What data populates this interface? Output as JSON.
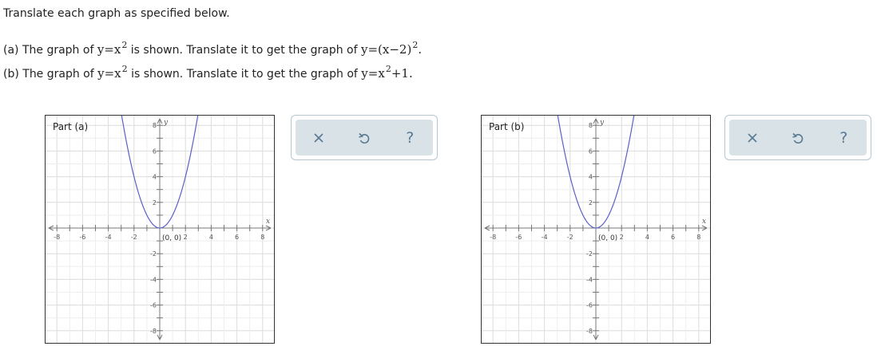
{
  "instructions": "Translate each graph as specified below.",
  "part_a": {
    "prefix": "(a) The graph of",
    "given_eq": "y=x",
    "given_exp": "2",
    "middle": "is shown. Translate it to get the graph of",
    "target_eq": "y=(x−2)",
    "target_exp": "2",
    "suffix": "."
  },
  "part_b": {
    "prefix": "(b) The graph of",
    "given_eq": "y=x",
    "given_exp": "2",
    "middle": "is shown. Translate it to get the graph of",
    "target_eq": "y=x",
    "target_exp": "2",
    "target_tail": "+1",
    "suffix": "."
  },
  "graphs": [
    {
      "label": "Part (a)",
      "vertex_label": "(0, 0)",
      "x_ticks": [
        "-8",
        "-6",
        "-4",
        "-2",
        "2",
        "4",
        "6",
        "8"
      ],
      "y_ticks": [
        "8",
        "6",
        "4",
        "2",
        "-2",
        "-4",
        "-6",
        "-8"
      ],
      "x_axis_label": "x",
      "y_axis_label": "y",
      "curve": {
        "equation": "y=x^2",
        "color": "#5b5fc7",
        "vertex": [
          0,
          0
        ]
      }
    },
    {
      "label": "Part (b)",
      "vertex_label": "(0, 0)",
      "x_ticks": [
        "-8",
        "-6",
        "-4",
        "-2",
        "2",
        "4",
        "6",
        "8"
      ],
      "y_ticks": [
        "8",
        "6",
        "4",
        "2",
        "-2",
        "-4",
        "-6",
        "-8"
      ],
      "x_axis_label": "x",
      "y_axis_label": "y",
      "curve": {
        "equation": "y=x^2",
        "color": "#5b5fc7",
        "vertex": [
          0,
          0
        ]
      }
    }
  ],
  "toolbar": {
    "clear_icon": "close-icon",
    "undo_icon": "undo-icon",
    "help_icon": "help-icon",
    "icon_color": "#5a7a93"
  }
}
